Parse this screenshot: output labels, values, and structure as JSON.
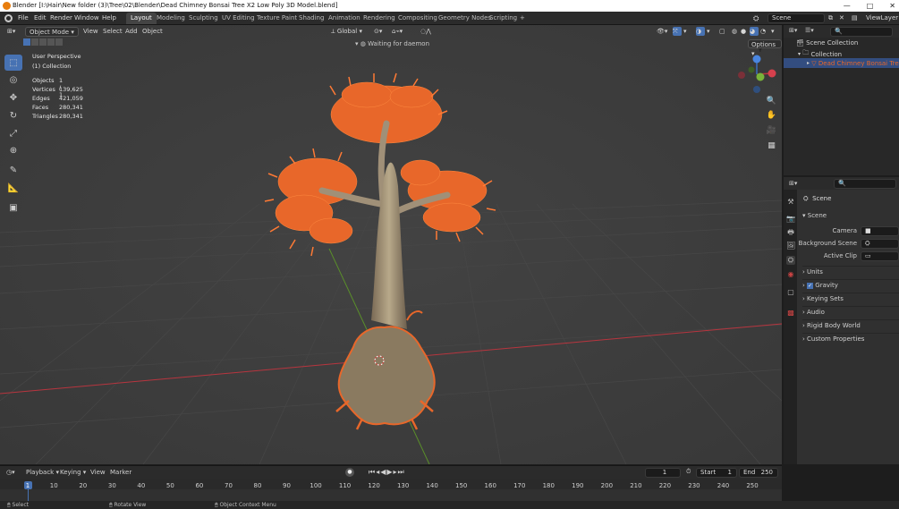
{
  "window_title": "Blender [I:\\Hair\\New folder (3)\\Tree\\02\\Blender\\Dead Chimney Bonsai Tree X2 Low Poly 3D Model.blend]",
  "window_controls": [
    "—",
    "□",
    "✕"
  ],
  "menu": [
    "File",
    "Edit",
    "Render",
    "Window",
    "Help"
  ],
  "workspaces": [
    "Layout",
    "Modeling",
    "Sculpting",
    "UV Editing",
    "Texture Paint",
    "Shading",
    "Animation",
    "Rendering",
    "Compositing",
    "Geometry Nodes",
    "Scripting",
    "+"
  ],
  "scene_field": "Scene",
  "viewlayer_field": "ViewLayer",
  "viewport_header": {
    "mode": "Object Mode",
    "menus": [
      "View",
      "Select",
      "Add",
      "Object"
    ],
    "transform": "Global",
    "status": "Waiting for daemon",
    "options": "Options"
  },
  "overlay": {
    "perspective": "User Perspective",
    "collection": "(1) Collection",
    "stats": [
      {
        "label": "Objects",
        "value": "1 / 1"
      },
      {
        "label": "Vertices",
        "value": "139,625"
      },
      {
        "label": "Edges",
        "value": "421,059"
      },
      {
        "label": "Faces",
        "value": "280,341"
      },
      {
        "label": "Triangles",
        "value": "280,341"
      }
    ]
  },
  "gizmo": {
    "x": "X",
    "y": "Y",
    "z": "Z"
  },
  "outliner": {
    "root": "Scene Collection",
    "collection": "Collection",
    "object": "Dead Chimney Bonsai Tree X2"
  },
  "properties": {
    "title": "Scene",
    "panel": "Scene",
    "camera_label": "Camera",
    "bg_label": "Background Scene",
    "clip_label": "Active Clip",
    "sections": [
      "Units",
      "Gravity",
      "Keying Sets",
      "Audio",
      "Rigid Body World",
      "Custom Properties"
    ]
  },
  "timeline": {
    "menus": [
      "Playback",
      "Keying",
      "View",
      "Marker"
    ],
    "current_frame": "1",
    "start_label": "Start",
    "start": "1",
    "end_label": "End",
    "end": "250",
    "ticks": [
      "1",
      "10",
      "20",
      "30",
      "40",
      "50",
      "60",
      "70",
      "80",
      "90",
      "100",
      "110",
      "120",
      "130",
      "140",
      "150",
      "160",
      "170",
      "180",
      "190",
      "200",
      "210",
      "220",
      "230",
      "240",
      "250"
    ]
  },
  "statusbar": {
    "select": "Select",
    "rotate": "Rotate View",
    "context": "Object Context Menu"
  },
  "colors": {
    "selection": "#e8672a",
    "accent": "#4772b3",
    "grid_x": "#b8353f",
    "grid_y": "#5a8f2a"
  }
}
